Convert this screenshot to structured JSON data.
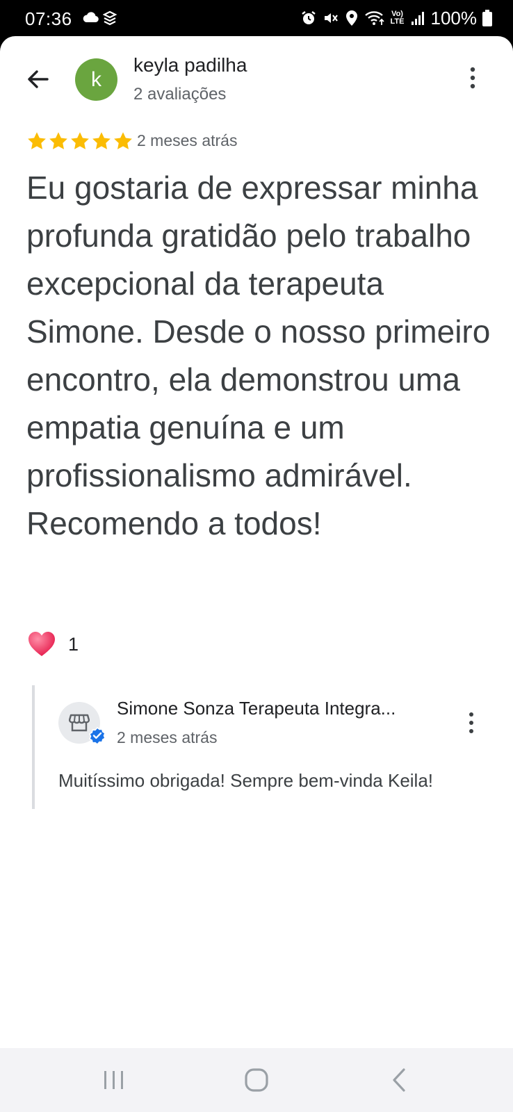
{
  "status_bar": {
    "time": "07:36",
    "battery": "100%",
    "network_label": "LTE",
    "volte_label": "Vo)"
  },
  "reviewer": {
    "avatar_letter": "k",
    "avatar_color": "#6aa53f",
    "name": "keyla padilha",
    "review_count": "2 avaliações"
  },
  "review": {
    "rating": 5,
    "star_color": "#fbbc04",
    "date": "2 meses atrás",
    "text": "Eu gostaria de expressar minha profunda gratidão pelo trabalho excepcional da terapeuta Simone. Desde o nosso primeiro encontro, ela demonstrou uma empatia genuína e um profissionalismo admirável. Recomendo a todos!",
    "reaction_icon": "heart-icon",
    "reaction_count": "1"
  },
  "owner_reply": {
    "name": "Simone Sonza Terapeuta Integra...",
    "date": "2 meses atrás",
    "text": "Muitíssimo obrigada! Sempre bem-vinda Keila!",
    "avatar_icon": "storefront-icon",
    "verified_color": "#1a73e8"
  },
  "icons": {
    "back": "arrow-back-icon",
    "more": "more-vert-icon",
    "nav_recent": "recent-apps-icon",
    "nav_home": "home-icon",
    "nav_back": "nav-back-icon"
  }
}
